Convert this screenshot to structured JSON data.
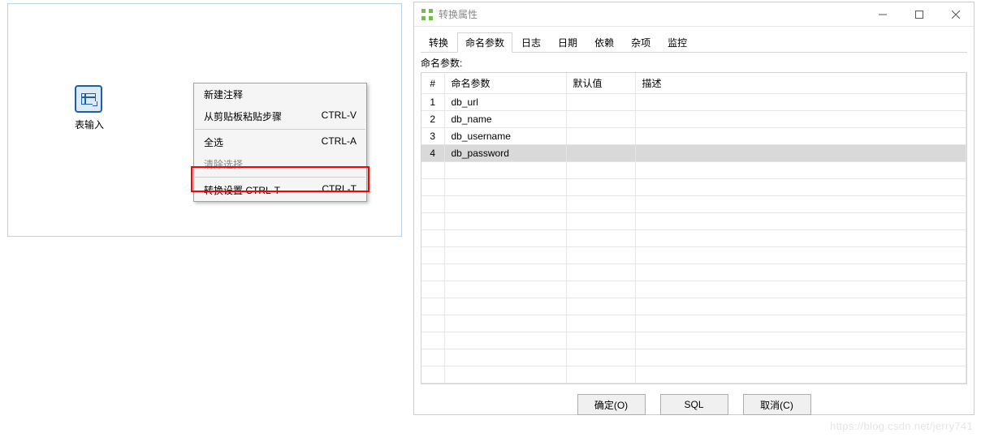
{
  "canvas": {
    "step_label": "表输入"
  },
  "context_menu": {
    "items": [
      {
        "label": "新建注释",
        "shortcut": "",
        "disabled": false
      },
      {
        "label": "从剪贴板粘贴步骤",
        "shortcut": "CTRL-V",
        "disabled": false
      },
      {
        "sep": true
      },
      {
        "label": "全选",
        "shortcut": "CTRL-A",
        "disabled": false
      },
      {
        "label": "清除选择",
        "shortcut": "",
        "disabled": true
      },
      {
        "sep": true
      },
      {
        "label": "转换设置 CTRL-T",
        "shortcut": "CTRL-T",
        "disabled": false
      }
    ]
  },
  "dialog": {
    "title": "转换属性",
    "tabs": [
      "转换",
      "命名参数",
      "日志",
      "日期",
      "依赖",
      "杂项",
      "监控"
    ],
    "active_tab": 1,
    "section_label": "命名参数:",
    "columns": {
      "num": "#",
      "name": "命名参数",
      "default": "默认值",
      "desc": "描述"
    },
    "rows": [
      {
        "num": "1",
        "name": "db_url",
        "default": "",
        "desc": ""
      },
      {
        "num": "2",
        "name": "db_name",
        "default": "",
        "desc": ""
      },
      {
        "num": "3",
        "name": "db_username",
        "default": "",
        "desc": ""
      },
      {
        "num": "4",
        "name": "db_password",
        "default": "",
        "desc": "",
        "selected": true
      }
    ],
    "buttons": {
      "ok": "确定(O)",
      "sql": "SQL",
      "cancel": "取消(C)"
    }
  },
  "watermark": "https://blog.csdn.net/jerry741"
}
